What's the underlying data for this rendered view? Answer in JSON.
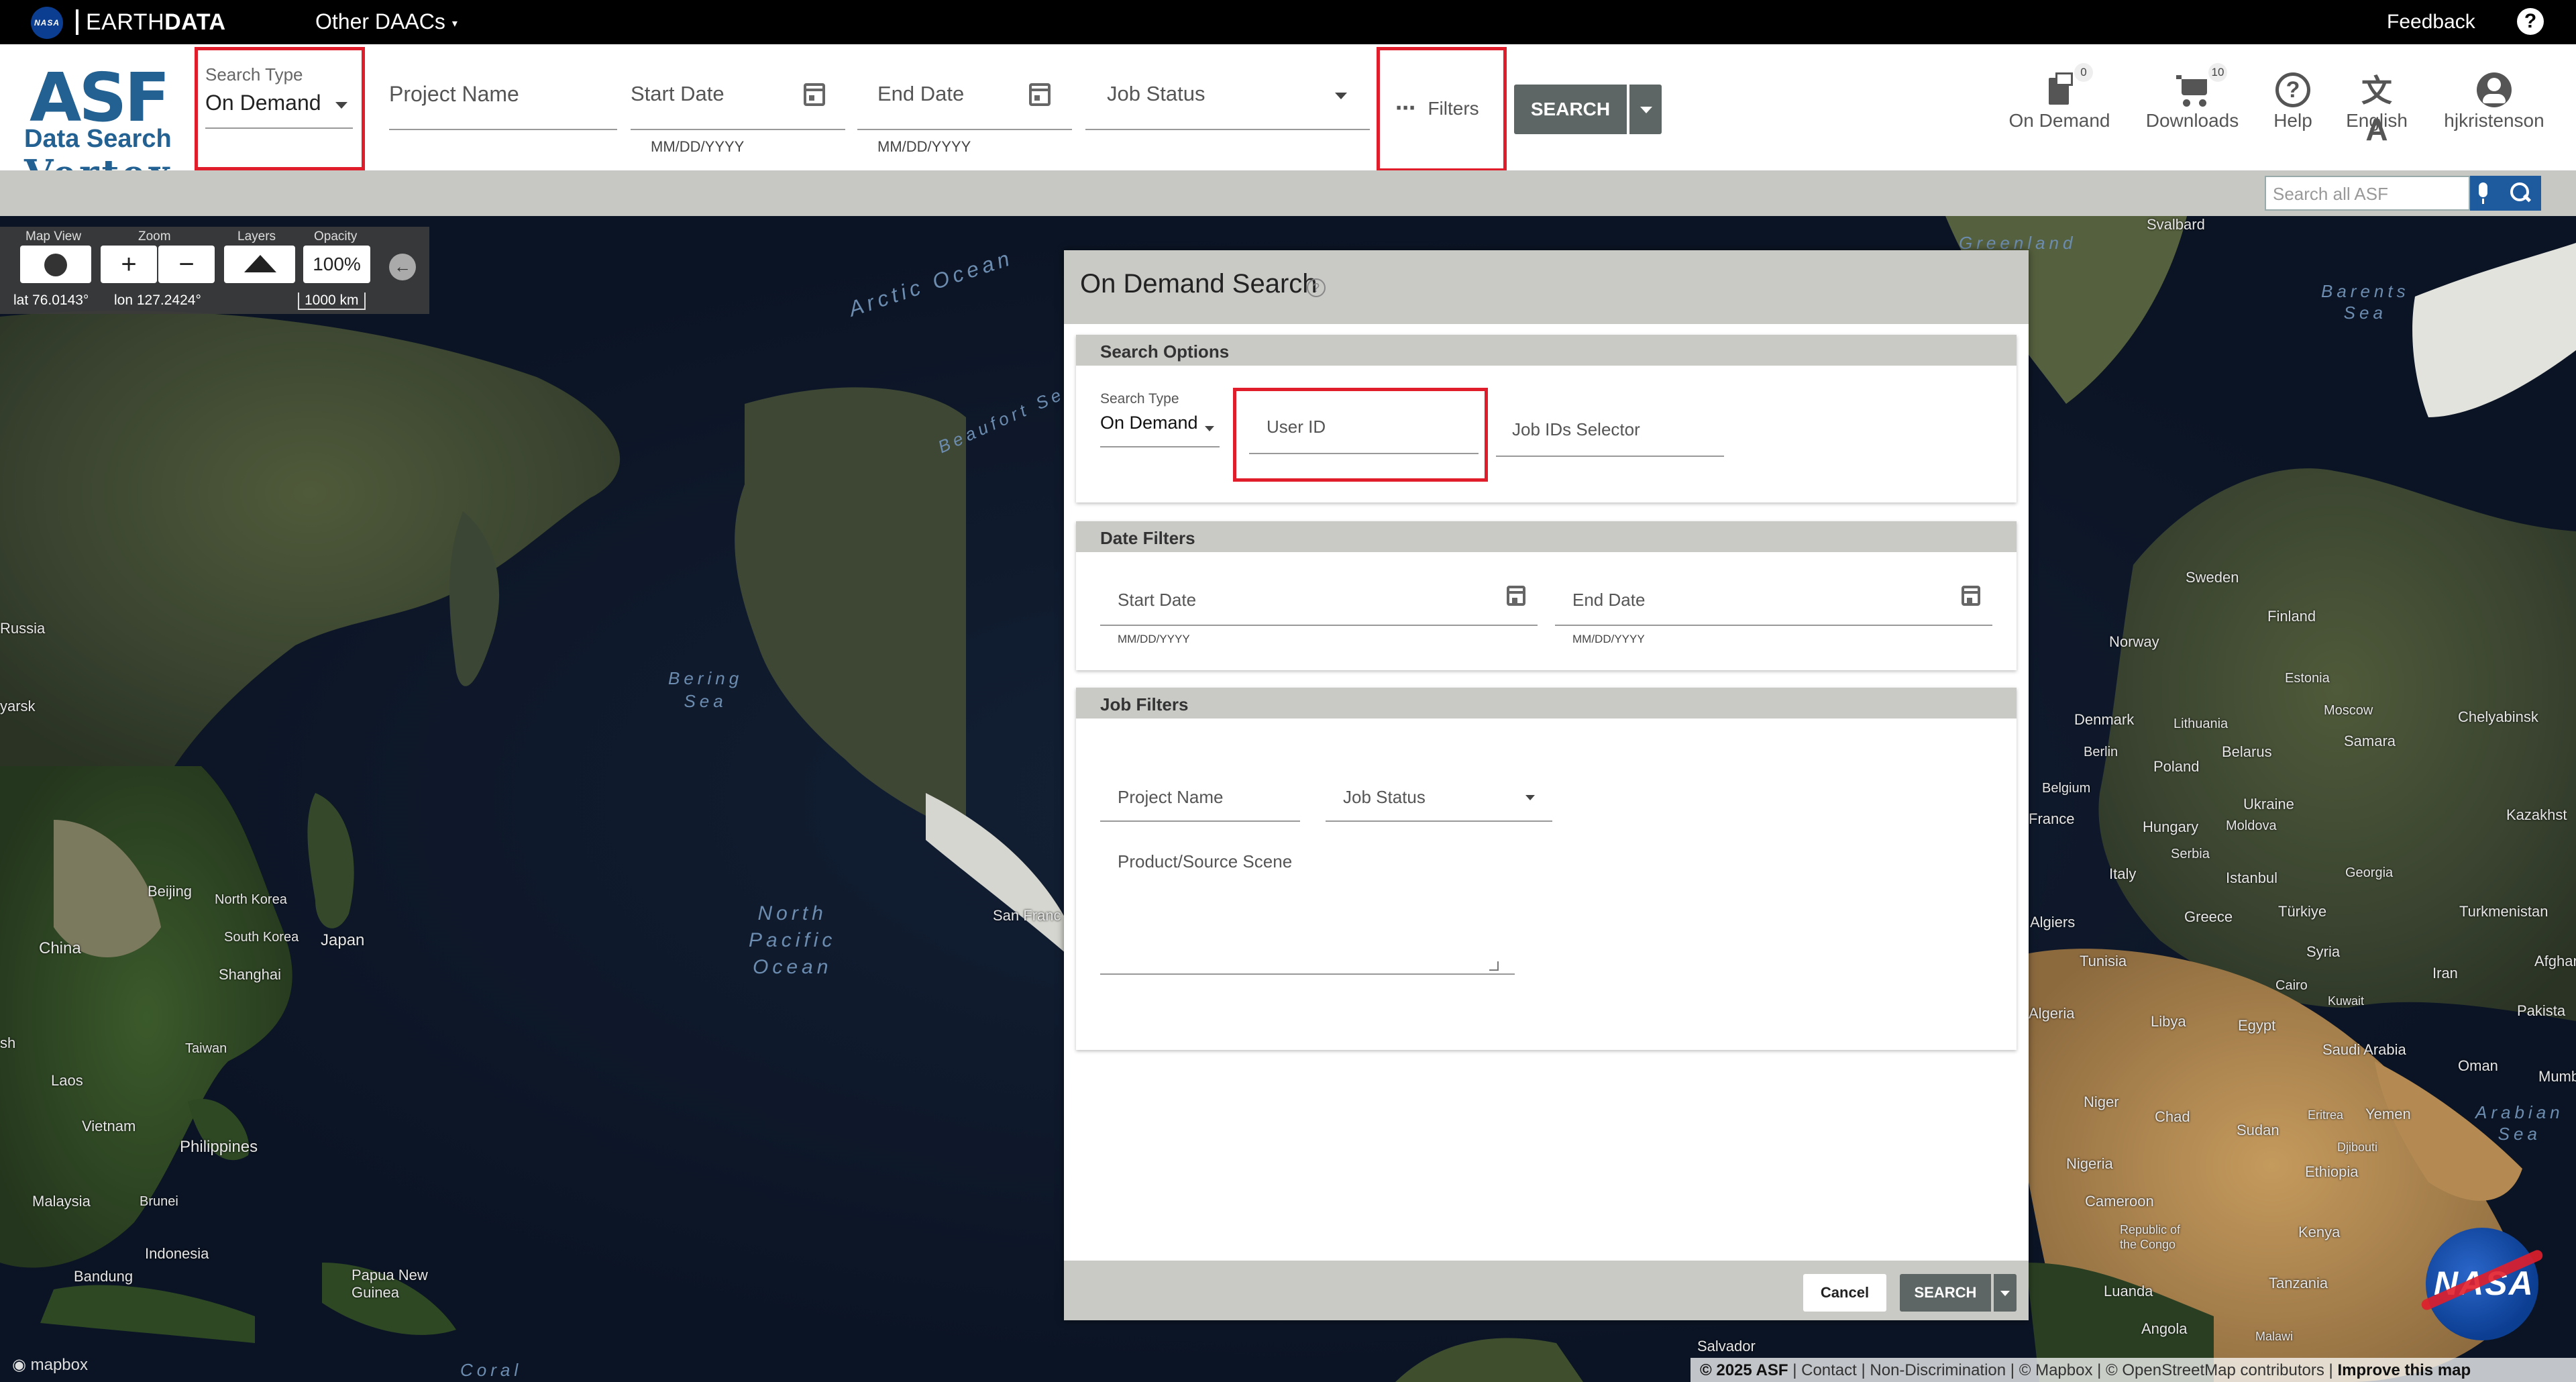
{
  "topbar": {
    "nasa_logo": "NASA",
    "earthdata_prefix": "EARTH",
    "earthdata_bold": "DATA",
    "other_daacs": "Other DAACs",
    "feedback": "Feedback",
    "help_icon": "question-circle-icon"
  },
  "logo": {
    "asf": "ASF",
    "data_search": "Data Search",
    "vertex": "Vertex"
  },
  "header": {
    "search_type_label": "Search Type",
    "search_type_value": "On Demand",
    "project_name_placeholder": "Project Name",
    "start_date_label": "Start Date",
    "start_date_hint": "MM/DD/YYYY",
    "end_date_label": "End Date",
    "end_date_hint": "MM/DD/YYYY",
    "job_status_label": "Job Status",
    "filters_label": "Filters",
    "filters_icon": "⋯",
    "search_button": "SEARCH",
    "tools": [
      {
        "label": "On Demand",
        "badge": "0",
        "icon": "on-demand-icon"
      },
      {
        "label": "Downloads",
        "badge": "10",
        "icon": "cart-icon"
      },
      {
        "label": "Help",
        "icon": "help-icon"
      },
      {
        "label": "English",
        "icon": "translate-icon"
      },
      {
        "label": "hjkristenson",
        "icon": "account-icon"
      }
    ],
    "search_all_placeholder": "Search all ASF"
  },
  "map_controls": {
    "map_view": "Map View",
    "zoom": "Zoom",
    "zoom_in": "+",
    "zoom_out": "−",
    "layers": "Layers",
    "opacity": "Opacity",
    "opacity_value": "100%",
    "lat": "lat 76.0143°",
    "lon": "lon 127.2424°",
    "scale": "1000 km"
  },
  "map_labels": {
    "greenland": "Greenland",
    "svalbard": "Svalbard",
    "barents": "Barents\nSea",
    "arctic": "Arctic Ocean",
    "beaufort": "Beaufort Sea",
    "russia": "Russia",
    "yarsk": "yarsk",
    "bering": "Bering\nSea",
    "north_pacific": "North\nPacific\nOcean",
    "beijing": "Beijing",
    "north_korea": "North Korea",
    "south_korea": "South Korea",
    "japan": "Japan",
    "china": "China",
    "shanghai": "Shanghai",
    "taiwan": "Taiwan",
    "laos": "Laos",
    "vietnam": "Vietnam",
    "philippines": "Philippines",
    "malaysia": "Malaysia",
    "brunei": "Brunei",
    "indonesia": "Indonesia",
    "bandung": "Bandung",
    "png": "Papua New\nGuinea",
    "coral": "Coral",
    "sh": "sh",
    "san_fran": "San Franc",
    "sweden": "Sweden",
    "finland": "Finland",
    "norway": "Norway",
    "estonia": "Estonia",
    "moscow": "Moscow",
    "chelyabinsk": "Chelyabinsk",
    "denmark": "Denmark",
    "lithuania": "Lithuania",
    "belarus": "Belarus",
    "samara": "Samara",
    "berlin": "Berlin",
    "poland": "Poland",
    "belgium": "Belgium",
    "ukraine": "Ukraine",
    "kazakhstan": "Kazakhst",
    "france": "France",
    "hungary": "Hungary",
    "moldova": "Moldova",
    "serbia": "Serbia",
    "georgia": "Georgia",
    "italy": "Italy",
    "istanbul": "Istanbul",
    "turkmenistan": "Turkmenistan",
    "turkiye": "Türkiye",
    "greece": "Greece",
    "algiers": "Algiers",
    "tunisia": "Tunisia",
    "syria": "Syria",
    "afghanistan": "Afghanista",
    "iran": "Iran",
    "cairo": "Cairo",
    "kuwait": "Kuwait",
    "pakistan": "Pakista",
    "algeria": "Algeria",
    "libya": "Libya",
    "egypt": "Egypt",
    "saudi": "Saudi Arabia",
    "oman": "Oman",
    "mumbai": "Mumba",
    "arabian": "Arabian\nSea",
    "niger": "Niger",
    "chad": "Chad",
    "sudan": "Sudan",
    "eritrea": "Eritrea",
    "yemen": "Yemen",
    "djibouti": "Djibouti",
    "nigeria": "Nigeria",
    "ethiopia": "Ethiopia",
    "cameroon": "Cameroon",
    "congo": "Republic of\nthe Congo",
    "kenya": "Kenya",
    "tanzania": "Tanzania",
    "luanda": "Luanda",
    "angola": "Angola",
    "malawi": "Malawi",
    "salvador": "Salvador"
  },
  "panel": {
    "title": "On Demand Search",
    "help_glyph": "?",
    "search_options": {
      "header": "Search Options",
      "search_type_label": "Search Type",
      "search_type_value": "On Demand",
      "user_id_placeholder": "User ID",
      "job_ids_placeholder": "Job IDs Selector"
    },
    "date_filters": {
      "header": "Date Filters",
      "start_label": "Start Date",
      "start_hint": "MM/DD/YYYY",
      "end_label": "End Date",
      "end_hint": "MM/DD/YYYY"
    },
    "job_filters": {
      "header": "Job Filters",
      "project_name_placeholder": "Project Name",
      "job_status_label": "Job Status",
      "product_scene_placeholder": "Product/Source Scene"
    },
    "cancel_button": "Cancel",
    "search_button": "SEARCH"
  },
  "attribution": {
    "copyright": "© 2025 ASF",
    "contact": "Contact",
    "nondiscrimination": "Non-Discrimination",
    "mapbox": "© Mapbox",
    "osm": "© OpenStreetMap contributors",
    "improve": "Improve this map",
    "brand": "mapbox"
  },
  "nasa_badge": "NASA",
  "colors": {
    "highlight_red": "#e01e2b",
    "asf_blue": "#236192",
    "button_grey": "#5d6664",
    "search_blue": "#1e5a9e"
  }
}
